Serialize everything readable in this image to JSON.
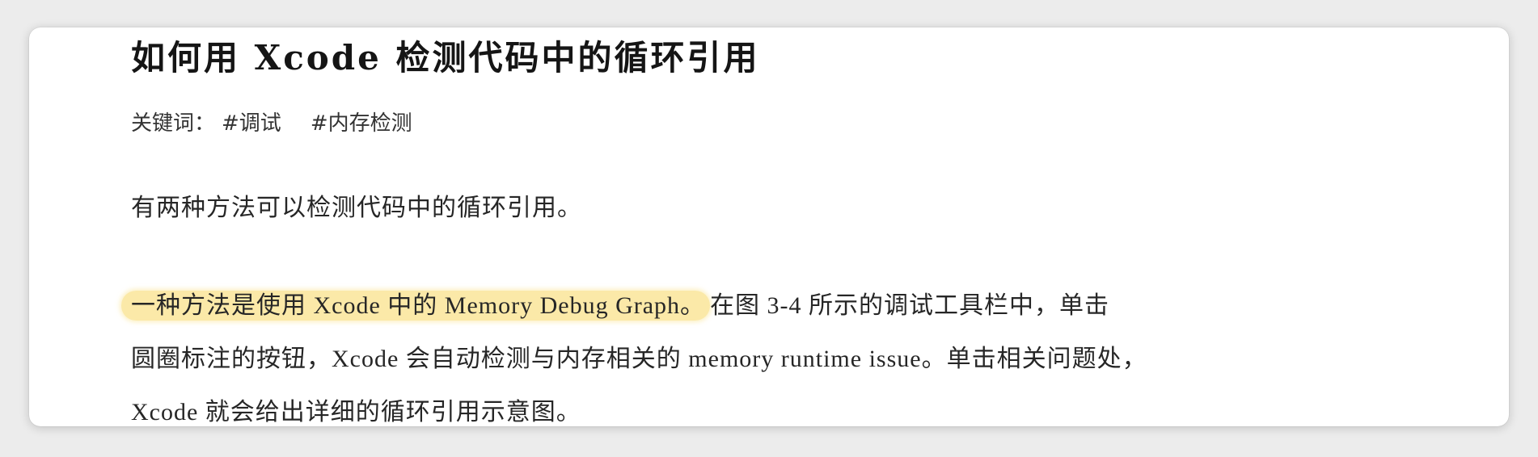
{
  "title": "如何用 Xcode 检测代码中的循环引用",
  "keywords": {
    "label": "关键词：",
    "tags": [
      "#调试",
      "#内存检测"
    ]
  },
  "paragraphs": {
    "intro": "有两种方法可以检测代码中的循环引用。",
    "method_highlight": "一种方法是使用 Xcode 中的 Memory Debug Graph。",
    "method_line1_rest": "在图 3-4 所示的调试工具栏中，单击",
    "method_line2": "圆圈标注的按钮，Xcode 会自动检测与内存相关的 memory runtime issue。单击相关问题处，",
    "method_line3": "Xcode 就会给出详细的循环引用示意图。"
  },
  "colors": {
    "highlight": "#fbe9a8",
    "text": "#262626",
    "background": "#ffffff"
  }
}
